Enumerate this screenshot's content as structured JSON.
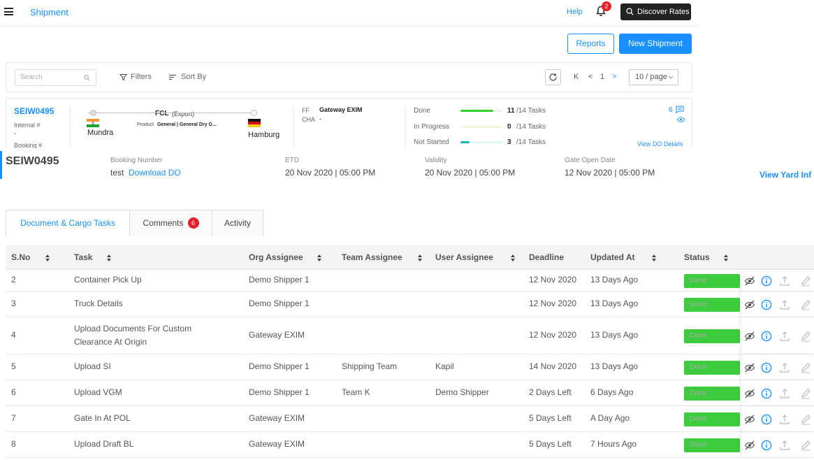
{
  "header": {
    "title": "Shipment",
    "help": "Help",
    "notif_count": "2",
    "discover": "Discover Rates"
  },
  "actions": {
    "reports": "Reports",
    "new_shipment": "New Shipment"
  },
  "filterbar": {
    "search_placeholder": "Search",
    "filters": "Filters",
    "sort_by": "Sort By",
    "first": "K",
    "prev": "<",
    "page": "1",
    "next": ">",
    "page_size": "10 / page"
  },
  "card": {
    "id": "SEIW0495",
    "internal_label": "Internal #",
    "internal_value": "-",
    "booking_label": "Booking #",
    "mode": "FCL",
    "mode_type": "(Export)",
    "product_label": "Product",
    "product_value": "General | General Dry G...",
    "origin": "Mundra",
    "destination": "Hamburg",
    "ff_label": "FF",
    "ff_value": "Gateway EXIM",
    "cha_label": "CHA",
    "cha_value": "-",
    "progress": [
      {
        "label": "Done",
        "value": "11",
        "total": "/14 Tasks",
        "fraction": 0.786,
        "color": "#2ed12e"
      },
      {
        "label": "In Progress",
        "value": "0",
        "total": "/14 Tasks",
        "fraction": 0.0,
        "color": "#f5e9a6"
      },
      {
        "label": "Not Started",
        "value": "3",
        "total": "/14 Tasks",
        "fraction": 0.214,
        "color": "#1eb1b1"
      }
    ],
    "comments_count": "6",
    "view_do": "View DO Details"
  },
  "detail": {
    "id": "SEIW0495",
    "booking_label": "Booking Number",
    "booking_value": "test",
    "download_do": "Download DO",
    "etd_label": "ETD",
    "etd_value": "20 Nov 2020 | 05:00 PM",
    "validity_label": "Validity",
    "validity_value": "20 Nov 2020 | 05:00 PM",
    "gate_label": "Gate Open Date",
    "gate_value": "12 Nov 2020 | 05:00 PM",
    "yard_link": "View Yard Inf"
  },
  "tabs": [
    {
      "label": "Document & Cargo Tasks",
      "active": true
    },
    {
      "label": "Comments",
      "count": "6"
    },
    {
      "label": "Activity"
    }
  ],
  "table": {
    "headers": [
      "S.No",
      "Task",
      "Org Assignee",
      "Team Assignee",
      "User Assignee",
      "Deadline",
      "Updated At",
      "Status"
    ],
    "rows": [
      {
        "sno": "2",
        "task": "Container Pick Up",
        "org": "Demo Shipper 1",
        "team": "",
        "user": "",
        "deadline": "12 Nov 2020",
        "updated": "13 Days Ago",
        "status": "Done"
      },
      {
        "sno": "3",
        "task": "Truck Details",
        "org": "Demo Shipper 1",
        "team": "",
        "user": "",
        "deadline": "12 Nov 2020",
        "updated": "13 Days Ago",
        "status": "Done"
      },
      {
        "sno": "4",
        "task": "Upload Documents For Custom Clearance At Origin",
        "org": "Gateway EXIM",
        "team": "",
        "user": "",
        "deadline": "12 Nov 2020",
        "updated": "13 Days Ago",
        "status": "Done"
      },
      {
        "sno": "5",
        "task": "Upload SI",
        "org": "Demo Shipper 1",
        "team": "Shipping Team",
        "user": "Kapil",
        "deadline": "14 Nov 2020",
        "updated": "13 Days Ago",
        "status": "Done"
      },
      {
        "sno": "6",
        "task": "Upload VGM",
        "org": "Demo Shipper 1",
        "team": "Team K",
        "user": "Demo Shipper",
        "deadline": "2 Days Left",
        "updated": "6 Days Ago",
        "status": "Done"
      },
      {
        "sno": "7",
        "task": "Gate In At POL",
        "org": "Gateway EXIM",
        "team": "",
        "user": "",
        "deadline": "5 Days Left",
        "updated": "A Day Ago",
        "status": "Done"
      },
      {
        "sno": "8",
        "task": "Upload Draft BL",
        "org": "Gateway EXIM",
        "team": "",
        "user": "",
        "deadline": "5 Days Left",
        "updated": "7 Hours Ago",
        "status": "Done"
      }
    ]
  }
}
